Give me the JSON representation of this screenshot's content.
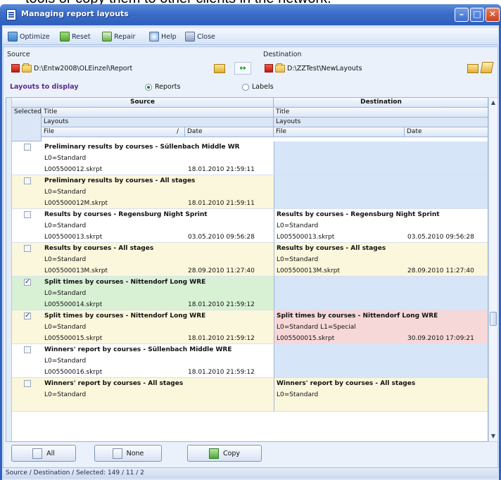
{
  "behind_text": "tools or copy them to other clients in the network.",
  "window": {
    "title": "Managing report layouts"
  },
  "toolbar": {
    "optimize": "Optimize",
    "reset": "Reset",
    "repair": "Repair",
    "help": "Help",
    "close": "Close"
  },
  "source": {
    "label": "Source",
    "path": "D:\\Entw2008\\OLEinzel\\Report"
  },
  "destination": {
    "label": "Destination",
    "path": "D:\\ZZTest\\NewLayouts"
  },
  "layouts_to_display": {
    "label": "Layouts to display",
    "options": [
      "Reports",
      "Labels"
    ],
    "selected": "Reports"
  },
  "grid": {
    "group_source": "Source",
    "group_destination": "Destination",
    "col_selected": "Selected",
    "col_title": "Title",
    "col_layouts": "Layouts",
    "col_file": "File",
    "sort_indicator": "/",
    "col_date": "Date",
    "rows": [
      {
        "checked": false,
        "bg": "#ffffff",
        "dest_bg": "#d6e6f8",
        "s_title": "Preliminary results by courses - Süllenbach Middle WR",
        "s_layouts": "L0=Standard",
        "s_file": "L005500012.skrpt",
        "s_date": "18.01.2010 21:59:11",
        "d_title": "",
        "d_layouts": "",
        "d_file": "",
        "d_date": ""
      },
      {
        "checked": false,
        "bg": "#fbf7dc",
        "dest_bg": "#d6e6f8",
        "s_title": "Preliminary results by courses - All stages",
        "s_layouts": "L0=Standard",
        "s_file": "L005500012M.skrpt",
        "s_date": "18.01.2010 21:59:11",
        "d_title": "",
        "d_layouts": "",
        "d_file": "",
        "d_date": ""
      },
      {
        "checked": false,
        "bg": "#ffffff",
        "dest_bg": "#ffffff",
        "s_title": "Results by courses - Regensburg Night Sprint",
        "s_layouts": "L0=Standard",
        "s_file": "L005500013.skrpt",
        "s_date": "03.05.2010 09:56:28",
        "d_title": "Results by courses - Regensburg Night Sprint",
        "d_layouts": "L0=Standard",
        "d_file": "L005500013.skrpt",
        "d_date": "03.05.2010 09:56:28"
      },
      {
        "checked": false,
        "bg": "#fbf7dc",
        "dest_bg": "#fbf7dc",
        "s_title": "Results by courses - All stages",
        "s_layouts": "L0=Standard",
        "s_file": "L005500013M.skrpt",
        "s_date": "28.09.2010 11:27:40",
        "d_title": "Results by courses - All stages",
        "d_layouts": "L0=Standard",
        "d_file": "L005500013M.skrpt",
        "d_date": "28.09.2010 11:27:40"
      },
      {
        "checked": true,
        "bg": "#d8f1d4",
        "dest_bg": "#d6e6f8",
        "s_title": "Split times by courses - Nittendorf Long WRE",
        "s_layouts": "L0=Standard",
        "s_file": "L005500014.skrpt",
        "s_date": "18.01.2010 21:59:12",
        "d_title": "",
        "d_layouts": "",
        "d_file": "",
        "d_date": ""
      },
      {
        "checked": true,
        "bg": "#fbf7dc",
        "dest_bg": "#f7d8d8",
        "s_title": "Split times by courses - Nittendorf Long WRE",
        "s_layouts": "L0=Standard",
        "s_file": "L005500015.skrpt",
        "s_date": "18.01.2010 21:59:12",
        "d_title": "Split times by courses - Nittendorf Long WRE",
        "d_layouts": "L0=Standard L1=Special",
        "d_file": "L005500015.skrpt",
        "d_date": "30.09.2010 17:09:21"
      },
      {
        "checked": false,
        "bg": "#ffffff",
        "dest_bg": "#d6e6f8",
        "s_title": "Winners' report by courses - Süllenbach Middle WRE",
        "s_layouts": "L0=Standard",
        "s_file": "L005500016.skrpt",
        "s_date": "18.01.2010 21:59:12",
        "d_title": "",
        "d_layouts": "",
        "d_file": "",
        "d_date": ""
      },
      {
        "checked": false,
        "bg": "#fbf7dc",
        "dest_bg": "#fbf7dc",
        "s_title": "Winners' report by courses - All stages",
        "s_layouts": "L0=Standard",
        "s_file": "",
        "s_date": "",
        "d_title": "Winners' report by courses - All stages",
        "d_layouts": "L0=Standard",
        "d_file": "",
        "d_date": ""
      }
    ]
  },
  "buttons": {
    "all": "All",
    "none": "None",
    "copy": "Copy"
  },
  "status": {
    "text": "Source / Destination / Selected:  149 / 11 / 2"
  }
}
